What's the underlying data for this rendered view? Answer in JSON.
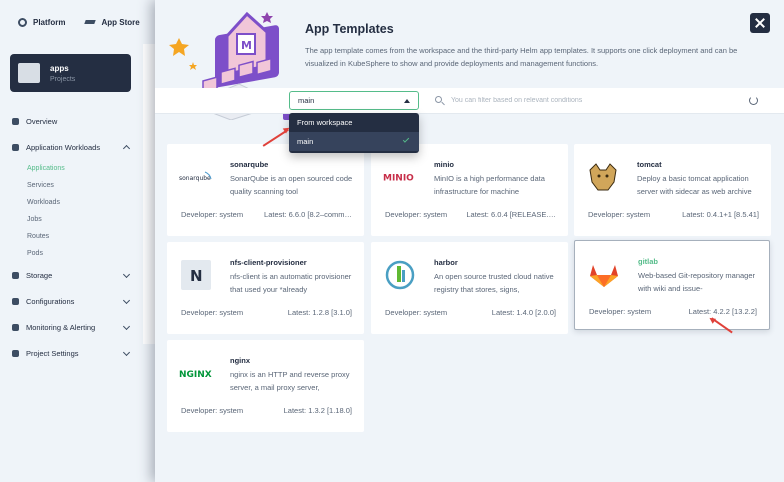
{
  "topbar": {
    "platform_label": "Platform",
    "appstore_label": "App Store"
  },
  "sidebar": {
    "workspace_name": "apps",
    "workspace_type": "Projects",
    "items": [
      {
        "label": "Overview"
      },
      {
        "label": "Application Workloads"
      },
      {
        "label": "Storage"
      },
      {
        "label": "Configurations"
      },
      {
        "label": "Monitoring & Alerting"
      },
      {
        "label": "Project Settings"
      }
    ],
    "subitems": [
      "Applications",
      "Services",
      "Workloads",
      "Jobs",
      "Routes",
      "Pods"
    ]
  },
  "overlay": {
    "title": "App Templates",
    "description": "The app template comes from the workspace and the third-party Helm app templates. It supports one click deployment and can be visualized in KubeSphere to show and provide deployments and management functions.",
    "repo_select_value": "main",
    "search_placeholder": "You can filter based on relevant conditions",
    "dropdown_options": [
      {
        "label": "From workspace"
      },
      {
        "label": "main",
        "selected": true
      }
    ]
  },
  "apps": [
    {
      "name": "sonarqube",
      "desc": "SonarQube is an open sourced code quality scanning tool",
      "developer": "Developer: system",
      "version": "Latest: 6.6.0 [8.2–comm…",
      "logo": "sonarqube",
      "logo_text": "sonarqube"
    },
    {
      "name": "minio",
      "desc": "MinIO is a high performance data infrastructure for machine",
      "developer": "Developer: system",
      "version": "Latest: 6.0.4 [RELEASE.…",
      "logo": "minio",
      "logo_text": "MINIO"
    },
    {
      "name": "tomcat",
      "desc": "Deploy a basic tomcat application server with sidecar as web archive",
      "developer": "Developer: system",
      "version": "Latest: 0.4.1+1 [8.5.41]",
      "logo": "tomcat"
    },
    {
      "name": "nfs-client-provisioner",
      "desc": "nfs-client is an automatic provisioner that used your *already",
      "developer": "Developer: system",
      "version": "Latest: 1.2.8 [3.1.0]",
      "logo": "nfs",
      "logo_text": "N"
    },
    {
      "name": "harbor",
      "desc": "An open source trusted cloud native registry that stores, signs,",
      "developer": "Developer: system",
      "version": "Latest: 1.4.0 [2.0.0]",
      "logo": "harbor"
    },
    {
      "name": "gitlab",
      "desc": "Web-based Git-repository manager with wiki and issue-",
      "developer": "Developer: system",
      "version": "Latest: 4.2.2 [13.2.2]",
      "logo": "gitlab"
    },
    {
      "name": "nginx",
      "desc": "nginx is an HTTP and reverse proxy server, a mail proxy server,",
      "developer": "Developer: system",
      "version": "Latest: 1.3.2 [1.18.0]",
      "logo": "nginx",
      "logo_text": "NGINX"
    }
  ],
  "colors": {
    "accent": "#55bc8a",
    "dark": "#242e42",
    "annotation_red": "#e0413a"
  }
}
